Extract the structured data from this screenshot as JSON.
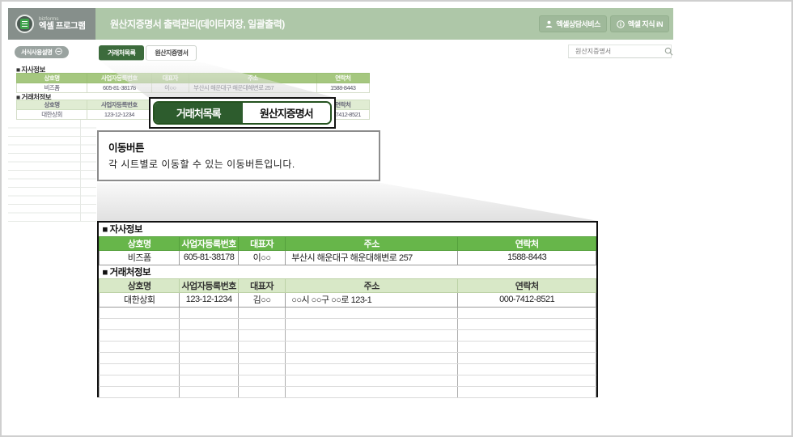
{
  "app": {
    "brand_small": "bizforms",
    "brand_name": "엑셀 프로그램",
    "title": "원산지증명서 출력관리(데이터저장, 일괄출력)",
    "header_buttons": [
      "엑셀상담서비스",
      "엑셀 지식 iN"
    ]
  },
  "toolbar": {
    "guide_button": "서식사용설명",
    "tabs": [
      "거래처목록",
      "원산지증명서"
    ],
    "search_value": "원산지증명서"
  },
  "sheet": {
    "columns": [
      "상호명",
      "사업자등록번호",
      "대표자",
      "주소",
      "연락처"
    ],
    "company": {
      "title": "■ 자사정보",
      "row": [
        "비즈폼",
        "605-81-38178",
        "이○○",
        "부산시 해운대구 해운대해변로 257",
        "1588-8443"
      ]
    },
    "clients": {
      "title": "■ 거래처정보",
      "row": [
        "대한상회",
        "123-12-1234",
        "김○○",
        "○○시 ○○구 ○○로 123-1",
        "000-7412-8521"
      ]
    }
  },
  "callout": {
    "title": "이동버튼",
    "description": "각 시트별로 이동할 수 있는 이동버튼입니다."
  },
  "icons": {
    "logo": "excel-document",
    "consult": "person",
    "knowledge": "info-circle",
    "guide": "minus-circle",
    "search": "magnifier"
  },
  "colors": {
    "header_green": "#aec7a8",
    "logo_gray": "#868f8b",
    "active_tab_green": "#3c6b3c",
    "callout_tab_green": "#2d5c2d",
    "table_header_green": "#67b64a",
    "table_subheader_green": "#d8e8c7"
  }
}
